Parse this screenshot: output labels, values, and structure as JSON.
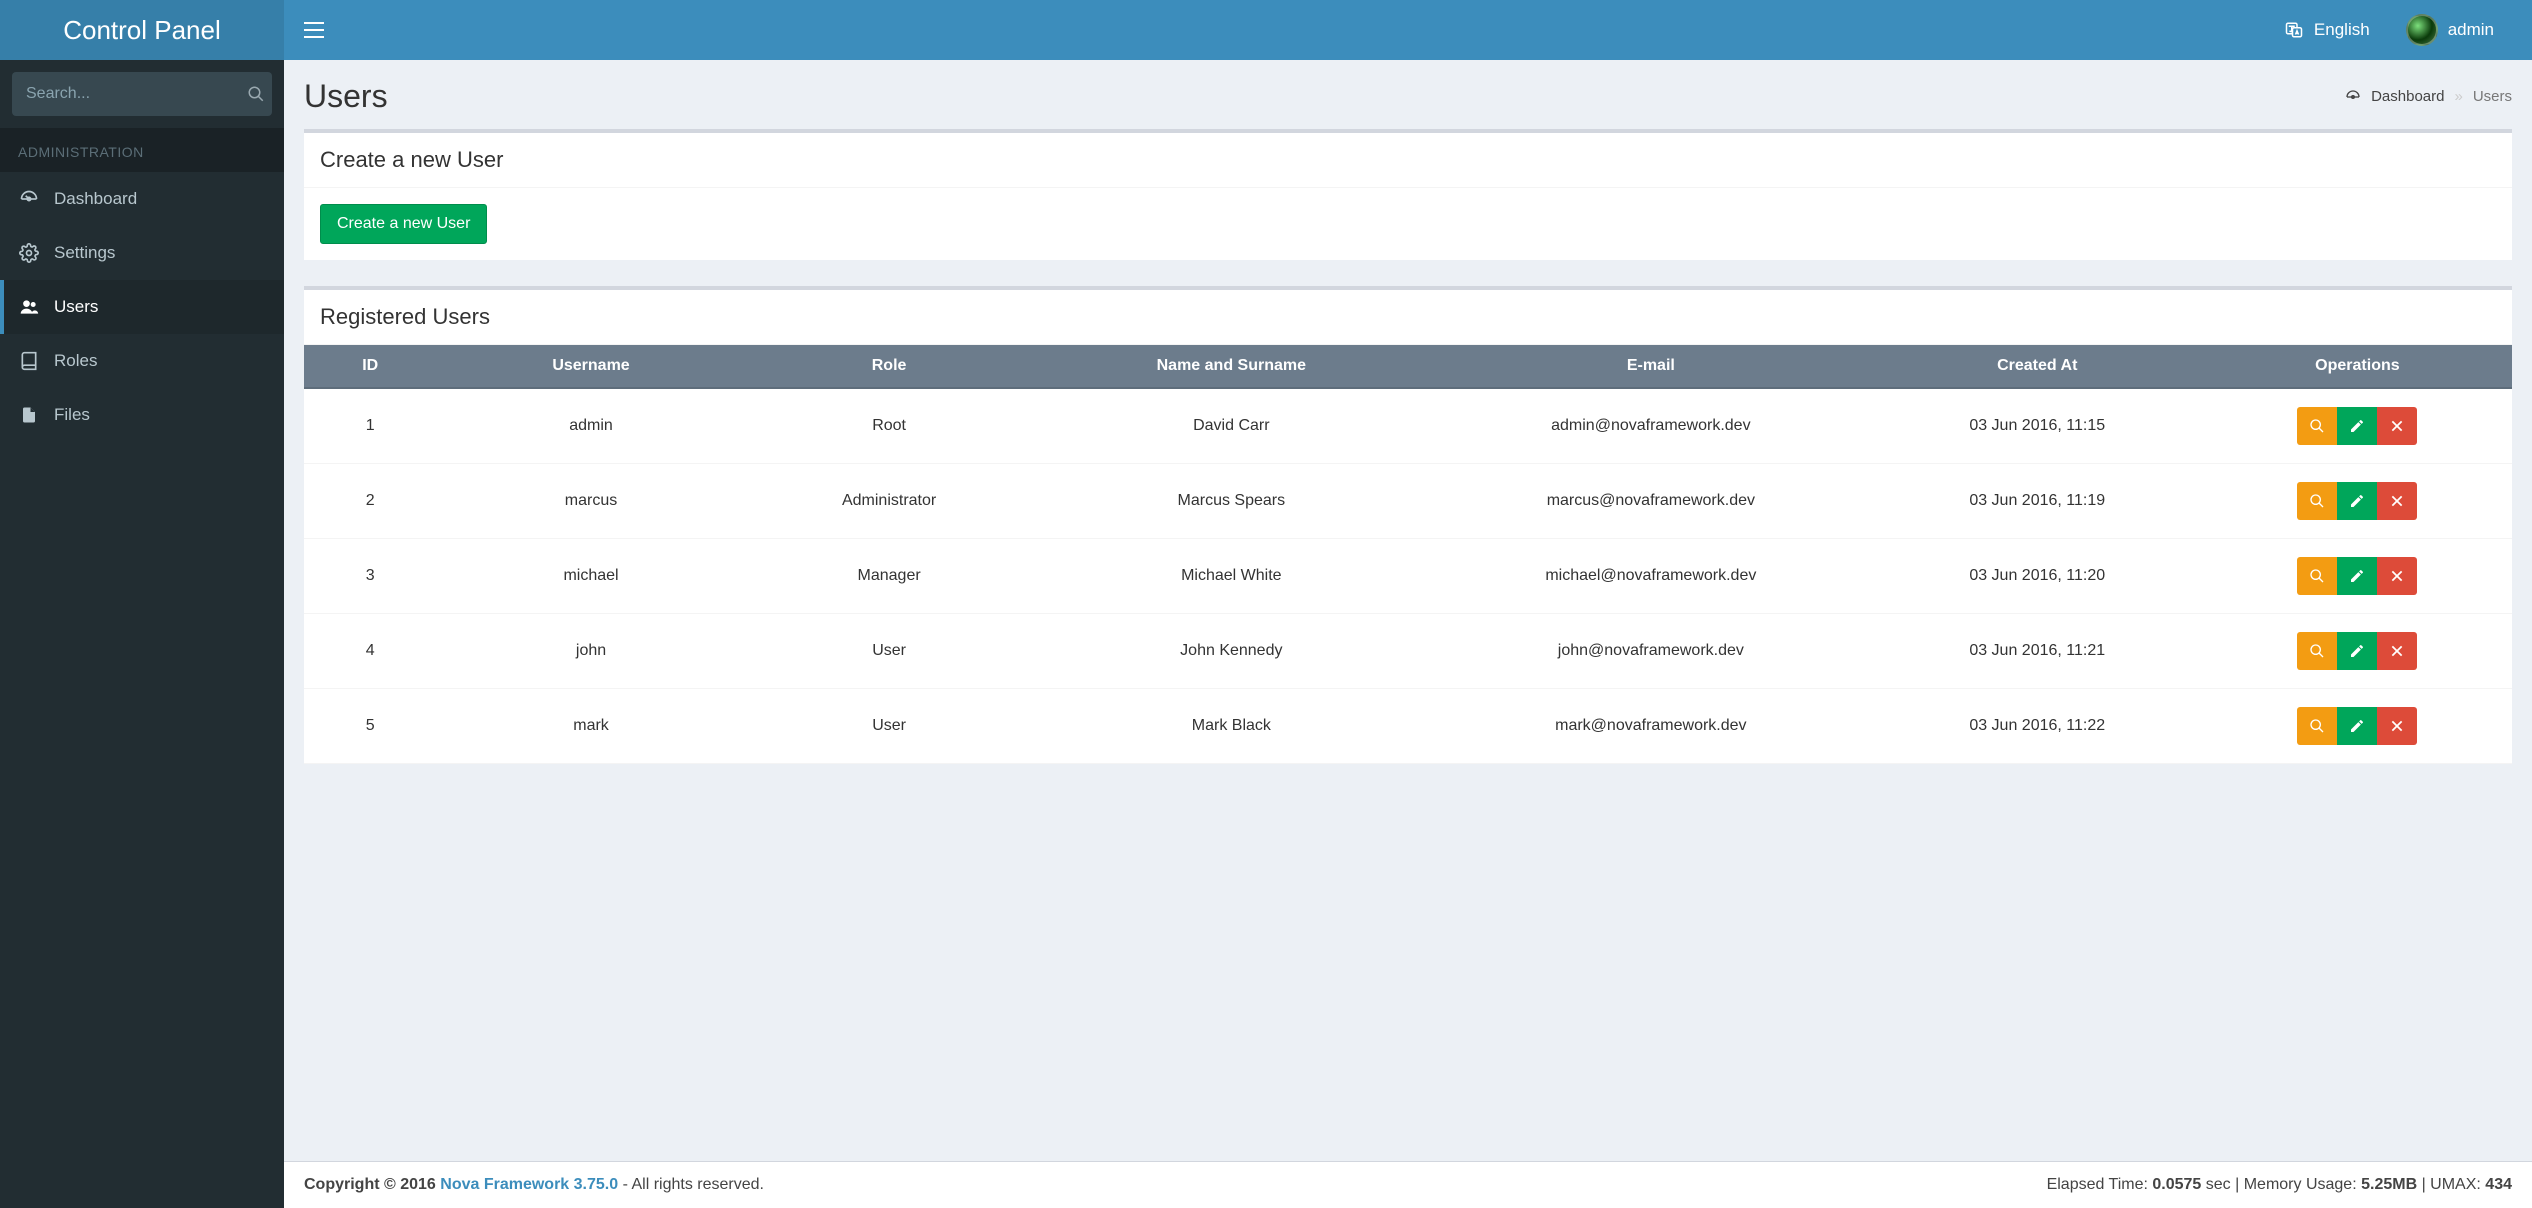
{
  "brand": "Control Panel",
  "search": {
    "placeholder": "Search..."
  },
  "nav": {
    "header": "ADMINISTRATION",
    "items": [
      {
        "label": "Dashboard"
      },
      {
        "label": "Settings"
      },
      {
        "label": "Users"
      },
      {
        "label": "Roles"
      },
      {
        "label": "Files"
      }
    ]
  },
  "topbar": {
    "language": "English",
    "username": "admin"
  },
  "page": {
    "title": "Users"
  },
  "breadcrumb": {
    "dashboard": "Dashboard",
    "current": "Users"
  },
  "create_panel": {
    "title": "Create a new User",
    "button": "Create a new User"
  },
  "table_panel": {
    "title": "Registered Users"
  },
  "table": {
    "headers": {
      "id": "ID",
      "username": "Username",
      "role": "Role",
      "name": "Name and Surname",
      "email": "E-mail",
      "created": "Created At",
      "ops": "Operations"
    },
    "rows": [
      {
        "id": "1",
        "username": "admin",
        "role": "Root",
        "name": "David Carr",
        "email": "admin@novaframework.dev",
        "created": "03 Jun 2016, 11:15"
      },
      {
        "id": "2",
        "username": "marcus",
        "role": "Administrator",
        "name": "Marcus Spears",
        "email": "marcus@novaframework.dev",
        "created": "03 Jun 2016, 11:19"
      },
      {
        "id": "3",
        "username": "michael",
        "role": "Manager",
        "name": "Michael White",
        "email": "michael@novaframework.dev",
        "created": "03 Jun 2016, 11:20"
      },
      {
        "id": "4",
        "username": "john",
        "role": "User",
        "name": "John Kennedy",
        "email": "john@novaframework.dev",
        "created": "03 Jun 2016, 11:21"
      },
      {
        "id": "5",
        "username": "mark",
        "role": "User",
        "name": "Mark Black",
        "email": "mark@novaframework.dev",
        "created": "03 Jun 2016, 11:22"
      }
    ]
  },
  "footer": {
    "copyright_prefix": "Copyright © 2016 ",
    "link_text": "Nova Framework 3.75.0",
    "copyright_suffix": " - All rights reserved.",
    "stats_prefix": "Elapsed Time: ",
    "elapsed": "0.0575",
    "stats_mid1": " sec | Memory Usage: ",
    "memory": "5.25MB",
    "stats_mid2": " | UMAX: ",
    "umax": "434"
  }
}
